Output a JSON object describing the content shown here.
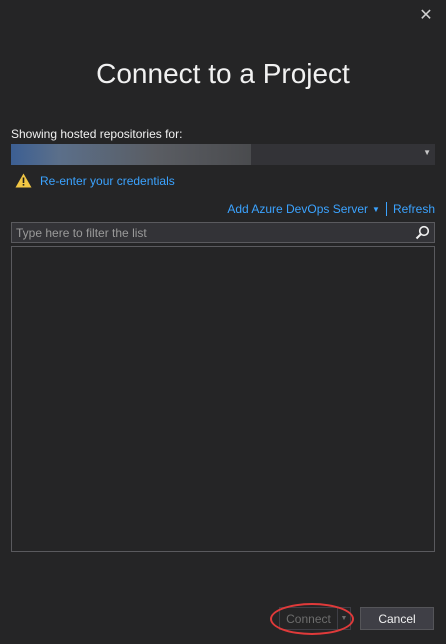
{
  "dialog": {
    "title": "Connect to a Project",
    "close_label": "✕"
  },
  "account": {
    "label": "Showing hosted repositories for:",
    "selected_value": ""
  },
  "warning": {
    "link_text": "Re-enter your credentials"
  },
  "toolbar": {
    "add_server_label": "Add Azure DevOps Server",
    "refresh_label": "Refresh"
  },
  "filter": {
    "placeholder": "Type here to filter the list",
    "value": ""
  },
  "repositories": [],
  "buttons": {
    "connect_label": "Connect",
    "cancel_label": "Cancel"
  },
  "colors": {
    "accent_link": "#3ba3ff",
    "warning_icon": "#f2c744",
    "highlight_ring": "#e03a3a"
  }
}
